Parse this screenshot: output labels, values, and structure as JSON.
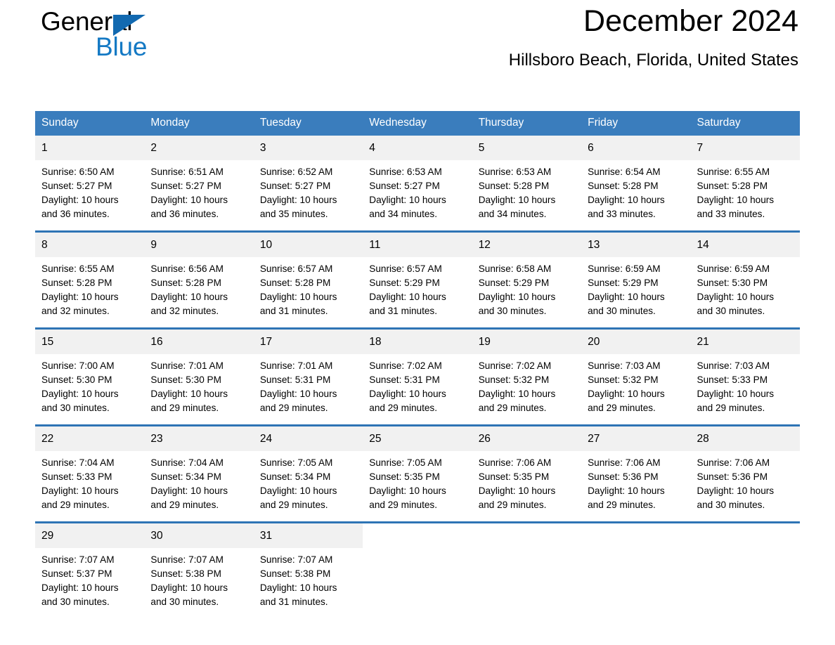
{
  "logo": {
    "word1": "General",
    "word2": "Blue",
    "triangle_color": "#1269b0",
    "blue_text_color": "#1479c4"
  },
  "header": {
    "title": "December 2024",
    "subtitle": "Hillsboro Beach, Florida, United States"
  },
  "colors": {
    "header_row_bg": "#3a7dbd",
    "header_row_text": "#ffffff",
    "row_divider": "#2e74b5",
    "date_band_bg": "#f1f1f1",
    "page_bg": "#ffffff",
    "text": "#000000"
  },
  "calendar": {
    "weekday_headers": [
      "Sunday",
      "Monday",
      "Tuesday",
      "Wednesday",
      "Thursday",
      "Friday",
      "Saturday"
    ],
    "weeks": [
      [
        {
          "date": "1",
          "detail": "Sunrise: 6:50 AM\nSunset: 5:27 PM\nDaylight: 10 hours\nand 36 minutes."
        },
        {
          "date": "2",
          "detail": "Sunrise: 6:51 AM\nSunset: 5:27 PM\nDaylight: 10 hours\nand 36 minutes."
        },
        {
          "date": "3",
          "detail": "Sunrise: 6:52 AM\nSunset: 5:27 PM\nDaylight: 10 hours\nand 35 minutes."
        },
        {
          "date": "4",
          "detail": "Sunrise: 6:53 AM\nSunset: 5:27 PM\nDaylight: 10 hours\nand 34 minutes."
        },
        {
          "date": "5",
          "detail": "Sunrise: 6:53 AM\nSunset: 5:28 PM\nDaylight: 10 hours\nand 34 minutes."
        },
        {
          "date": "6",
          "detail": "Sunrise: 6:54 AM\nSunset: 5:28 PM\nDaylight: 10 hours\nand 33 minutes."
        },
        {
          "date": "7",
          "detail": "Sunrise: 6:55 AM\nSunset: 5:28 PM\nDaylight: 10 hours\nand 33 minutes."
        }
      ],
      [
        {
          "date": "8",
          "detail": "Sunrise: 6:55 AM\nSunset: 5:28 PM\nDaylight: 10 hours\nand 32 minutes."
        },
        {
          "date": "9",
          "detail": "Sunrise: 6:56 AM\nSunset: 5:28 PM\nDaylight: 10 hours\nand 32 minutes."
        },
        {
          "date": "10",
          "detail": "Sunrise: 6:57 AM\nSunset: 5:28 PM\nDaylight: 10 hours\nand 31 minutes."
        },
        {
          "date": "11",
          "detail": "Sunrise: 6:57 AM\nSunset: 5:29 PM\nDaylight: 10 hours\nand 31 minutes."
        },
        {
          "date": "12",
          "detail": "Sunrise: 6:58 AM\nSunset: 5:29 PM\nDaylight: 10 hours\nand 30 minutes."
        },
        {
          "date": "13",
          "detail": "Sunrise: 6:59 AM\nSunset: 5:29 PM\nDaylight: 10 hours\nand 30 minutes."
        },
        {
          "date": "14",
          "detail": "Sunrise: 6:59 AM\nSunset: 5:30 PM\nDaylight: 10 hours\nand 30 minutes."
        }
      ],
      [
        {
          "date": "15",
          "detail": "Sunrise: 7:00 AM\nSunset: 5:30 PM\nDaylight: 10 hours\nand 30 minutes."
        },
        {
          "date": "16",
          "detail": "Sunrise: 7:01 AM\nSunset: 5:30 PM\nDaylight: 10 hours\nand 29 minutes."
        },
        {
          "date": "17",
          "detail": "Sunrise: 7:01 AM\nSunset: 5:31 PM\nDaylight: 10 hours\nand 29 minutes."
        },
        {
          "date": "18",
          "detail": "Sunrise: 7:02 AM\nSunset: 5:31 PM\nDaylight: 10 hours\nand 29 minutes."
        },
        {
          "date": "19",
          "detail": "Sunrise: 7:02 AM\nSunset: 5:32 PM\nDaylight: 10 hours\nand 29 minutes."
        },
        {
          "date": "20",
          "detail": "Sunrise: 7:03 AM\nSunset: 5:32 PM\nDaylight: 10 hours\nand 29 minutes."
        },
        {
          "date": "21",
          "detail": "Sunrise: 7:03 AM\nSunset: 5:33 PM\nDaylight: 10 hours\nand 29 minutes."
        }
      ],
      [
        {
          "date": "22",
          "detail": "Sunrise: 7:04 AM\nSunset: 5:33 PM\nDaylight: 10 hours\nand 29 minutes."
        },
        {
          "date": "23",
          "detail": "Sunrise: 7:04 AM\nSunset: 5:34 PM\nDaylight: 10 hours\nand 29 minutes."
        },
        {
          "date": "24",
          "detail": "Sunrise: 7:05 AM\nSunset: 5:34 PM\nDaylight: 10 hours\nand 29 minutes."
        },
        {
          "date": "25",
          "detail": "Sunrise: 7:05 AM\nSunset: 5:35 PM\nDaylight: 10 hours\nand 29 minutes."
        },
        {
          "date": "26",
          "detail": "Sunrise: 7:06 AM\nSunset: 5:35 PM\nDaylight: 10 hours\nand 29 minutes."
        },
        {
          "date": "27",
          "detail": "Sunrise: 7:06 AM\nSunset: 5:36 PM\nDaylight: 10 hours\nand 29 minutes."
        },
        {
          "date": "28",
          "detail": "Sunrise: 7:06 AM\nSunset: 5:36 PM\nDaylight: 10 hours\nand 30 minutes."
        }
      ],
      [
        {
          "date": "29",
          "detail": "Sunrise: 7:07 AM\nSunset: 5:37 PM\nDaylight: 10 hours\nand 30 minutes."
        },
        {
          "date": "30",
          "detail": "Sunrise: 7:07 AM\nSunset: 5:38 PM\nDaylight: 10 hours\nand 30 minutes."
        },
        {
          "date": "31",
          "detail": "Sunrise: 7:07 AM\nSunset: 5:38 PM\nDaylight: 10 hours\nand 31 minutes."
        },
        {
          "date": "",
          "detail": ""
        },
        {
          "date": "",
          "detail": ""
        },
        {
          "date": "",
          "detail": ""
        },
        {
          "date": "",
          "detail": ""
        }
      ]
    ]
  }
}
